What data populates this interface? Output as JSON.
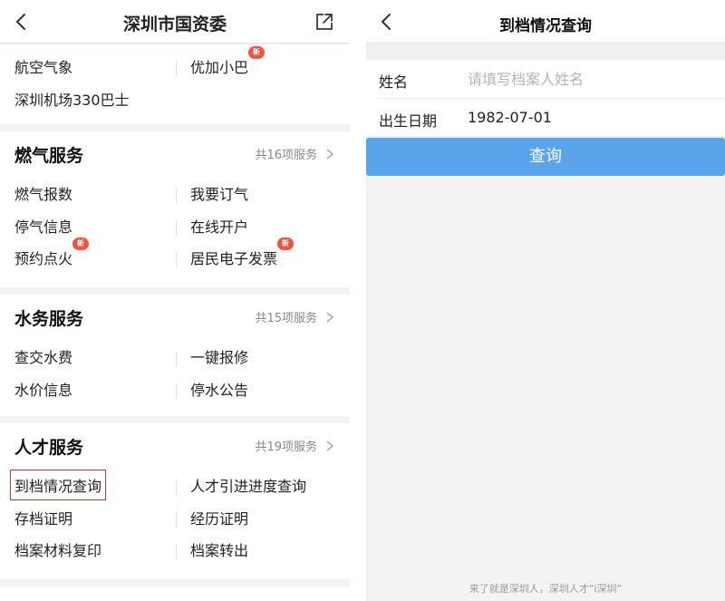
{
  "left": {
    "title": "深圳市国资委",
    "top_section": {
      "rows": [
        [
          {
            "label": "航空气象",
            "new": false
          },
          {
            "label": "优加小巴",
            "new": true
          }
        ],
        [
          {
            "label": "深圳机场330巴士",
            "new": false
          },
          null
        ]
      ]
    },
    "sections": [
      {
        "title": "燃气服务",
        "more": "共16项服务",
        "rows": [
          [
            {
              "label": "燃气报数",
              "new": false
            },
            {
              "label": "我要订气",
              "new": false
            }
          ],
          [
            {
              "label": "停气信息",
              "new": false
            },
            {
              "label": "在线开户",
              "new": false
            }
          ],
          [
            {
              "label": "预约点火",
              "new": true
            },
            {
              "label": "居民电子发票",
              "new": true
            }
          ]
        ]
      },
      {
        "title": "水务服务",
        "more": "共15项服务",
        "rows": [
          [
            {
              "label": "查交水费",
              "new": false
            },
            {
              "label": "一键报修",
              "new": false
            }
          ],
          [
            {
              "label": "水价信息",
              "new": false
            },
            {
              "label": "停水公告",
              "new": false
            }
          ]
        ]
      },
      {
        "title": "人才服务",
        "more": "共19项服务",
        "rows": [
          [
            {
              "label": "到档情况查询",
              "new": false,
              "highlight": true
            },
            {
              "label": "人才引进进度查询",
              "new": false
            }
          ],
          [
            {
              "label": "存档证明",
              "new": false
            },
            {
              "label": "经历证明",
              "new": false
            }
          ],
          [
            {
              "label": "档案材料复印",
              "new": false
            },
            {
              "label": "档案转出",
              "new": false
            }
          ]
        ]
      }
    ],
    "badge_text": "新"
  },
  "right": {
    "title": "到档情况查询",
    "form": {
      "name_label": "姓名",
      "name_placeholder": "请填写档案人姓名",
      "name_value": "",
      "birth_label": "出生日期",
      "birth_value": "1982-07-01"
    },
    "query_button": "查询",
    "footer": "来了就是深圳人，深圳人才“i深圳”"
  },
  "colors": {
    "accent_blue": "#5aa4ec",
    "badge_red": "#f0533f",
    "highlight_box": "#c83a33"
  },
  "icons": {
    "back": "chevron-left-icon",
    "share": "share-icon",
    "more": "chevron-right-icon"
  }
}
